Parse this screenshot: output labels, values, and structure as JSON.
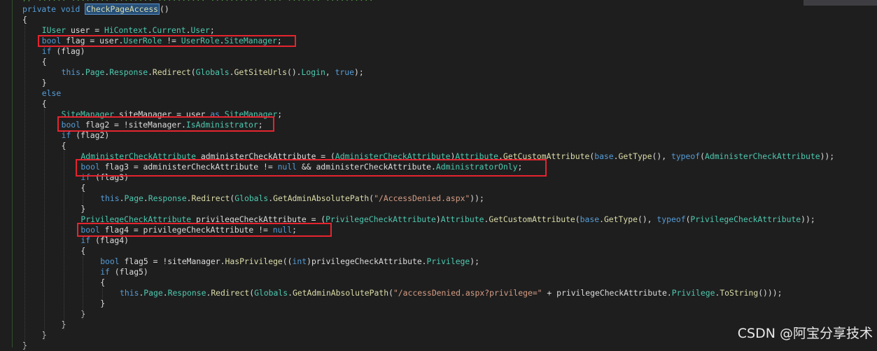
{
  "editor": {
    "truncated_comment": "// ...... ........ ........ .......... .......... .... ....... ..........",
    "lines": [
      {
        "indent": 0,
        "tokens": [
          {
            "t": "private",
            "c": "kw"
          },
          {
            "t": " "
          },
          {
            "t": "void",
            "c": "kw"
          },
          {
            "t": " "
          },
          {
            "t": "CheckPageAccess",
            "c": "hl"
          },
          {
            "t": "()"
          }
        ]
      },
      {
        "indent": 0,
        "tokens": [
          {
            "t": "{"
          }
        ]
      },
      {
        "indent": 1,
        "tokens": [
          {
            "t": "IUser",
            "c": "type"
          },
          {
            "t": " user = "
          },
          {
            "t": "HiContext",
            "c": "type"
          },
          {
            "t": "."
          },
          {
            "t": "Current",
            "c": "prop"
          },
          {
            "t": "."
          },
          {
            "t": "User",
            "c": "prop"
          },
          {
            "t": ";"
          }
        ]
      },
      {
        "indent": 1,
        "tokens": [
          {
            "t": "bool",
            "c": "kw"
          },
          {
            "t": " flag = user."
          },
          {
            "t": "UserRole",
            "c": "prop"
          },
          {
            "t": " != "
          },
          {
            "t": "UserRole",
            "c": "type"
          },
          {
            "t": "."
          },
          {
            "t": "SiteManager",
            "c": "prop"
          },
          {
            "t": ";"
          }
        ]
      },
      {
        "indent": 1,
        "tokens": [
          {
            "t": "if",
            "c": "kw"
          },
          {
            "t": " (flag)"
          }
        ]
      },
      {
        "indent": 1,
        "tokens": [
          {
            "t": "{"
          }
        ]
      },
      {
        "indent": 2,
        "tokens": [
          {
            "t": "this",
            "c": "kw"
          },
          {
            "t": "."
          },
          {
            "t": "Page",
            "c": "prop"
          },
          {
            "t": "."
          },
          {
            "t": "Response",
            "c": "prop"
          },
          {
            "t": "."
          },
          {
            "t": "Redirect",
            "c": "fn"
          },
          {
            "t": "("
          },
          {
            "t": "Globals",
            "c": "type"
          },
          {
            "t": "."
          },
          {
            "t": "GetSiteUrls",
            "c": "fn"
          },
          {
            "t": "()."
          },
          {
            "t": "Login",
            "c": "prop"
          },
          {
            "t": ", "
          },
          {
            "t": "true",
            "c": "kw"
          },
          {
            "t": ");"
          }
        ]
      },
      {
        "indent": 1,
        "tokens": [
          {
            "t": "}"
          }
        ]
      },
      {
        "indent": 1,
        "tokens": [
          {
            "t": "else",
            "c": "kw"
          }
        ]
      },
      {
        "indent": 1,
        "tokens": [
          {
            "t": "{"
          }
        ]
      },
      {
        "indent": 2,
        "tokens": [
          {
            "t": "SiteManager",
            "c": "type"
          },
          {
            "t": " siteManager = user "
          },
          {
            "t": "as",
            "c": "kw"
          },
          {
            "t": " "
          },
          {
            "t": "SiteManager",
            "c": "type"
          },
          {
            "t": ";"
          }
        ]
      },
      {
        "indent": 2,
        "tokens": [
          {
            "t": "bool",
            "c": "kw"
          },
          {
            "t": " flag2 = !siteManager."
          },
          {
            "t": "IsAdministrator",
            "c": "prop"
          },
          {
            "t": ";"
          }
        ]
      },
      {
        "indent": 2,
        "tokens": [
          {
            "t": "if",
            "c": "kw"
          },
          {
            "t": " (flag2)"
          }
        ]
      },
      {
        "indent": 2,
        "tokens": [
          {
            "t": "{"
          }
        ]
      },
      {
        "indent": 3,
        "tokens": [
          {
            "t": "AdministerCheckAttribute",
            "c": "type"
          },
          {
            "t": " administerCheckAttribute = ("
          },
          {
            "t": "AdministerCheckAttribute",
            "c": "type"
          },
          {
            "t": ")"
          },
          {
            "t": "Attribute",
            "c": "type"
          },
          {
            "t": "."
          },
          {
            "t": "GetCustomAttribute",
            "c": "fn"
          },
          {
            "t": "("
          },
          {
            "t": "base",
            "c": "kw"
          },
          {
            "t": "."
          },
          {
            "t": "GetType",
            "c": "fn"
          },
          {
            "t": "(), "
          },
          {
            "t": "typeof",
            "c": "kw"
          },
          {
            "t": "("
          },
          {
            "t": "AdministerCheckAttribute",
            "c": "type"
          },
          {
            "t": "));"
          }
        ]
      },
      {
        "indent": 3,
        "tokens": [
          {
            "t": "bool",
            "c": "kw"
          },
          {
            "t": " flag3 = administerCheckAttribute != "
          },
          {
            "t": "null",
            "c": "kw"
          },
          {
            "t": " && administerCheckAttribute."
          },
          {
            "t": "AdministratorOnly",
            "c": "prop"
          },
          {
            "t": ";"
          }
        ]
      },
      {
        "indent": 3,
        "tokens": [
          {
            "t": "if",
            "c": "kw"
          },
          {
            "t": " (flag3)"
          }
        ]
      },
      {
        "indent": 3,
        "tokens": [
          {
            "t": "{"
          }
        ]
      },
      {
        "indent": 4,
        "tokens": [
          {
            "t": "this",
            "c": "kw"
          },
          {
            "t": "."
          },
          {
            "t": "Page",
            "c": "prop"
          },
          {
            "t": "."
          },
          {
            "t": "Response",
            "c": "prop"
          },
          {
            "t": "."
          },
          {
            "t": "Redirect",
            "c": "fn"
          },
          {
            "t": "("
          },
          {
            "t": "Globals",
            "c": "type"
          },
          {
            "t": "."
          },
          {
            "t": "GetAdminAbsolutePath",
            "c": "fn"
          },
          {
            "t": "("
          },
          {
            "t": "\"/AccessDenied.aspx\"",
            "c": "str"
          },
          {
            "t": "));"
          }
        ]
      },
      {
        "indent": 3,
        "tokens": [
          {
            "t": "}"
          }
        ]
      },
      {
        "indent": 3,
        "tokens": [
          {
            "t": "PrivilegeCheckAttribute",
            "c": "type"
          },
          {
            "t": " privilegeCheckAttribute = ("
          },
          {
            "t": "PrivilegeCheckAttribute",
            "c": "type"
          },
          {
            "t": ")"
          },
          {
            "t": "Attribute",
            "c": "type"
          },
          {
            "t": "."
          },
          {
            "t": "GetCustomAttribute",
            "c": "fn"
          },
          {
            "t": "("
          },
          {
            "t": "base",
            "c": "kw"
          },
          {
            "t": "."
          },
          {
            "t": "GetType",
            "c": "fn"
          },
          {
            "t": "(), "
          },
          {
            "t": "typeof",
            "c": "kw"
          },
          {
            "t": "("
          },
          {
            "t": "PrivilegeCheckAttribute",
            "c": "type"
          },
          {
            "t": "));"
          }
        ]
      },
      {
        "indent": 3,
        "tokens": [
          {
            "t": "bool",
            "c": "kw"
          },
          {
            "t": " flag4 = privilegeCheckAttribute != "
          },
          {
            "t": "null",
            "c": "kw"
          },
          {
            "t": ";"
          }
        ]
      },
      {
        "indent": 3,
        "tokens": [
          {
            "t": "if",
            "c": "kw"
          },
          {
            "t": " (flag4)"
          }
        ]
      },
      {
        "indent": 3,
        "tokens": [
          {
            "t": "{"
          }
        ]
      },
      {
        "indent": 4,
        "tokens": [
          {
            "t": "bool",
            "c": "kw"
          },
          {
            "t": " flag5 = !siteManager."
          },
          {
            "t": "HasPrivilege",
            "c": "fn"
          },
          {
            "t": "(("
          },
          {
            "t": "int",
            "c": "kw"
          },
          {
            "t": ")privilegeCheckAttribute."
          },
          {
            "t": "Privilege",
            "c": "prop"
          },
          {
            "t": ");"
          }
        ]
      },
      {
        "indent": 4,
        "tokens": [
          {
            "t": "if",
            "c": "kw"
          },
          {
            "t": " (flag5)"
          }
        ]
      },
      {
        "indent": 4,
        "tokens": [
          {
            "t": "{"
          }
        ]
      },
      {
        "indent": 5,
        "tokens": [
          {
            "t": "this",
            "c": "kw"
          },
          {
            "t": "."
          },
          {
            "t": "Page",
            "c": "prop"
          },
          {
            "t": "."
          },
          {
            "t": "Response",
            "c": "prop"
          },
          {
            "t": "."
          },
          {
            "t": "Redirect",
            "c": "fn"
          },
          {
            "t": "("
          },
          {
            "t": "Globals",
            "c": "type"
          },
          {
            "t": "."
          },
          {
            "t": "GetAdminAbsolutePath",
            "c": "fn"
          },
          {
            "t": "("
          },
          {
            "t": "\"/accessDenied.aspx?privilege=\"",
            "c": "str"
          },
          {
            "t": " + privilegeCheckAttribute."
          },
          {
            "t": "Privilege",
            "c": "prop"
          },
          {
            "t": "."
          },
          {
            "t": "ToString",
            "c": "fn"
          },
          {
            "t": "()));"
          }
        ]
      },
      {
        "indent": 4,
        "tokens": [
          {
            "t": "}"
          }
        ]
      },
      {
        "indent": 3,
        "tokens": [
          {
            "t": "}"
          }
        ]
      },
      {
        "indent": 2,
        "tokens": [
          {
            "t": "}"
          }
        ]
      },
      {
        "indent": 1,
        "tokens": [
          {
            "t": "}"
          }
        ]
      },
      {
        "indent": 0,
        "tokens": [
          {
            "t": "}"
          }
        ]
      }
    ]
  },
  "highlight_boxes": [
    "flag",
    "flag2",
    "flag3",
    "flag4"
  ],
  "watermark": "CSDN @阿宝分享技术",
  "colors": {
    "keyword": "#569cd6",
    "type": "#4ec9b0",
    "method": "#dcdcaa",
    "string": "#d69d85",
    "text": "#dcdcdc",
    "background": "#1e1e1e",
    "annotation_box": "#e5242f"
  }
}
